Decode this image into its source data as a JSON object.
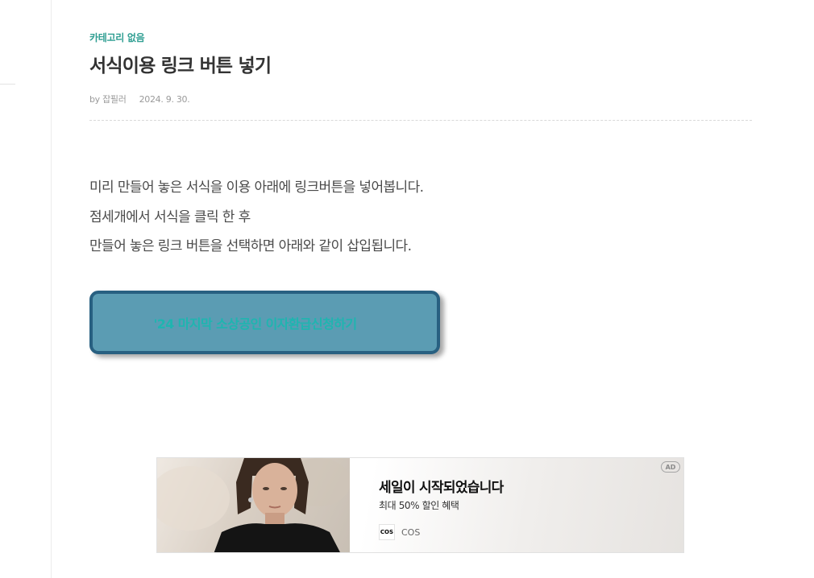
{
  "post": {
    "category": "카테고리 없음",
    "title": "서식이용 링크 버튼 넣기",
    "author": "by 잡필러",
    "date": "2024. 9. 30."
  },
  "content": {
    "paragraphs": [
      "미리 만들어 놓은 서식을 이용 아래에 링크버튼을 넣어봅니다.",
      "점세개에서 서식을 클릭 한 후",
      "만들어 놓은 링크 버튼을 선택하면 아래와 같이 삽입됩니다."
    ],
    "link_button": {
      "label": "'24 마지막 소상공인 이자환급신청하기",
      "background": "#5b9cb3",
      "border": "#286081",
      "text_color": "#1fb5b0"
    }
  },
  "ad": {
    "headline": "세일이 시작되었습니다",
    "subline": "최대 50% 할인 혜택",
    "brand_logo": "COS",
    "brand_name": "COS",
    "badge": "AD"
  },
  "colors": {
    "accent": "#2f9e92",
    "title": "#333333",
    "meta": "#9a9a9a"
  }
}
